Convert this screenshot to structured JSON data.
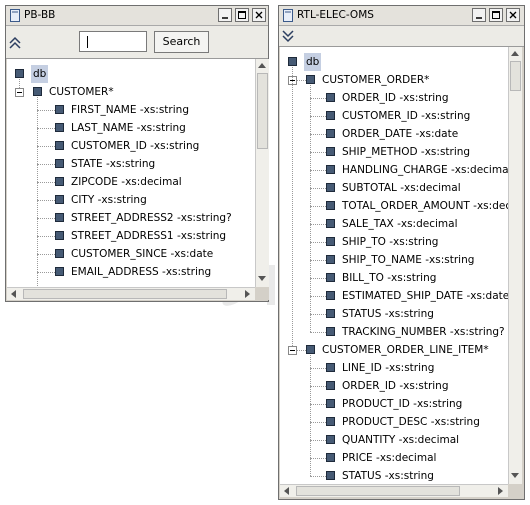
{
  "windows": [
    {
      "title": "PB-BB",
      "search_placeholder": "",
      "search_button": "Search",
      "root": "db",
      "group": "CUSTOMER*",
      "fields": [
        "FIRST_NAME -xs:string",
        "LAST_NAME -xs:string",
        "CUSTOMER_ID -xs:string",
        "STATE -xs:string",
        "ZIPCODE -xs:decimal",
        "CITY -xs:string",
        "STREET_ADDRESS2 -xs:string?",
        "STREET_ADDRESS1 -xs:string",
        "CUSTOMER_SINCE -xs:date",
        "EMAIL_ADDRESS -xs:string"
      ]
    },
    {
      "title": "RTL-ELEC-OMS",
      "root": "db",
      "groups": [
        {
          "name": "CUSTOMER_ORDER*",
          "fields": [
            "ORDER_ID -xs:string",
            "CUSTOMER_ID -xs:string",
            "ORDER_DATE -xs:date",
            "SHIP_METHOD -xs:string",
            "HANDLING_CHARGE -xs:decimal",
            "SUBTOTAL -xs:decimal",
            "TOTAL_ORDER_AMOUNT -xs:decimal",
            "SALE_TAX -xs:decimal",
            "SHIP_TO -xs:string",
            "SHIP_TO_NAME -xs:string",
            "BILL_TO -xs:string",
            "ESTIMATED_SHIP_DATE -xs:date",
            "STATUS -xs:string",
            "TRACKING_NUMBER -xs:string?"
          ]
        },
        {
          "name": "CUSTOMER_ORDER_LINE_ITEM*",
          "fields": [
            "LINE_ID -xs:string",
            "ORDER_ID -xs:string",
            "PRODUCT_ID -xs:string",
            "PRODUCT_DESC -xs:string",
            "QUANTITY -xs:decimal",
            "PRICE -xs:decimal",
            "STATUS -xs:string"
          ]
        }
      ]
    }
  ],
  "colors": {
    "node": "#465a74",
    "selection": "#c5cfe2",
    "chrome": "#d4d0c8"
  },
  "icons": [
    "db-window-icon",
    "minimize-icon",
    "maximize-icon",
    "close-icon",
    "collapse-up-icon",
    "expand-down-icon",
    "tree-node-icon",
    "tree-collapse-toggle-icon"
  ]
}
